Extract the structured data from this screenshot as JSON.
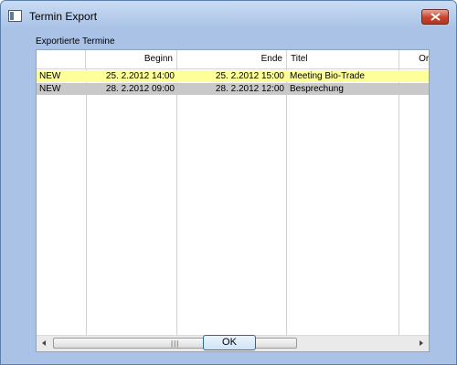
{
  "window": {
    "title": "Termin Export"
  },
  "group": {
    "label": "Exportierte Termine"
  },
  "list": {
    "columns": [
      "",
      "Beginn",
      "Ende",
      "Titel",
      "Ort"
    ],
    "rows": [
      {
        "status": "NEW",
        "beginn": "25.  2.2012  14:00",
        "ende": "25.  2.2012  15:00",
        "titel": "Meeting Bio-Trade",
        "ort": "",
        "highlight": "#ffff9a"
      },
      {
        "status": "NEW",
        "beginn": "28.  2.2012  09:00",
        "ende": "28.  2.2012  12:00",
        "titel": "Besprechung",
        "ort": "",
        "highlight": "#c9c9c9"
      }
    ]
  },
  "buttons": {
    "ok_label": "OK"
  },
  "colors": {
    "window_bg": "#a9c2e6",
    "close_button": "#c8422d",
    "selected_row": "#ffff9a",
    "second_row": "#c9c9c9"
  },
  "icons": {
    "app": "window-icon",
    "close": "close-icon"
  }
}
